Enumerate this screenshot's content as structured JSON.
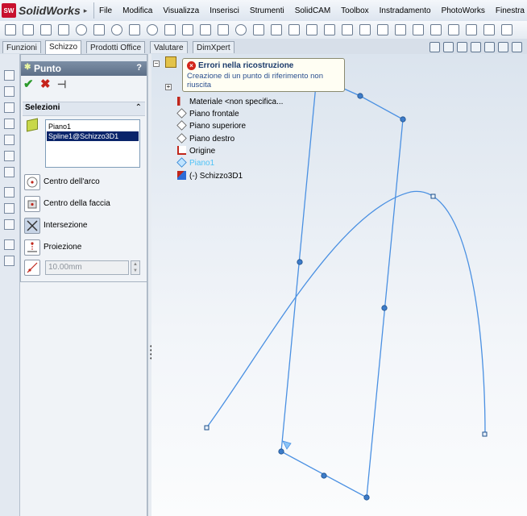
{
  "app": {
    "name": "SolidWorks",
    "logo_mark": "SW"
  },
  "menu": [
    "File",
    "Modifica",
    "Visualizza",
    "Inserisci",
    "Strumenti",
    "SolidCAM",
    "Toolbox",
    "Instradamento",
    "PhotoWorks",
    "Finestra",
    "?"
  ],
  "tabs": [
    "Funzioni",
    "Schizzo",
    "Prodotti Office",
    "Valutare",
    "DimXpert"
  ],
  "active_tab": "Schizzo",
  "panel": {
    "title": "Punto",
    "help": "?",
    "ok_icon": "check-icon",
    "cancel_icon": "x-icon",
    "pin_icon": "pushpin-icon",
    "ok_glyph": "✔",
    "cancel_glyph": "✖",
    "pin_glyph": "⊣",
    "section_title": "Selezioni",
    "section_collapse": "⌃",
    "selections": [
      "Piano1",
      "Spline1@Schizzo3D1"
    ],
    "selected_index": 1,
    "options": [
      {
        "label": "Centro dell'arco",
        "icon": "arc-center-icon"
      },
      {
        "label": "Centro della faccia",
        "icon": "face-center-icon"
      },
      {
        "label": "Intersezione",
        "icon": "intersection-icon",
        "pressed": true
      },
      {
        "label": "Proiezione",
        "icon": "projection-icon"
      }
    ],
    "distance_value": "10.00mm"
  },
  "tree": {
    "items": [
      {
        "label": "Materiale <non specifica...",
        "icon": "material-icon"
      },
      {
        "label": "Piano frontale",
        "icon": "plane-icon"
      },
      {
        "label": "Piano superiore",
        "icon": "plane-icon"
      },
      {
        "label": "Piano destro",
        "icon": "plane-icon"
      },
      {
        "label": "Origine",
        "icon": "origin-icon"
      },
      {
        "label": "Piano1",
        "icon": "plane-icon",
        "highlight": true
      },
      {
        "label": "(-) Schizzo3D1",
        "icon": "sketch3d-icon"
      }
    ]
  },
  "tooltip": {
    "title": "Errori nella ricostruzione",
    "body": "Creazione di un punto di riferimento non riuscita",
    "icon": "error-icon",
    "icon_glyph": "×"
  },
  "colors": {
    "sketch": "#4a90e2",
    "selection": "#0a246a",
    "accent": "#c8102e"
  }
}
